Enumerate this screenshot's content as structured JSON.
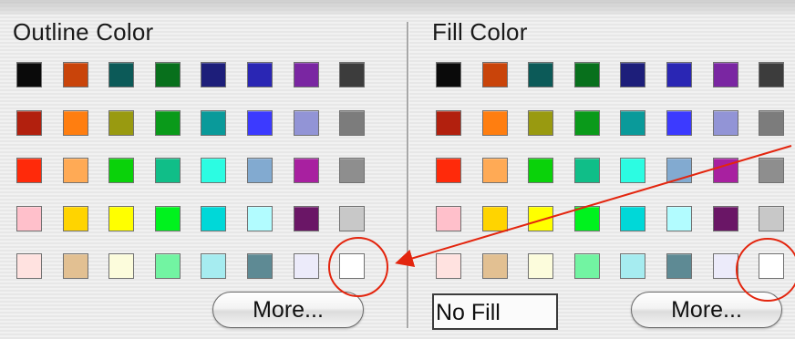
{
  "outline_panel": {
    "title": "Outline Color",
    "more_label": "More..."
  },
  "fill_panel": {
    "title": "Fill Color",
    "no_fill_label": "No Fill",
    "more_label": "More..."
  },
  "palette": [
    [
      "#0a0a0a",
      "#c9440a",
      "#0c5a58",
      "#08701c",
      "#1d1e7a",
      "#2a26b4",
      "#7a26a2",
      "#3c3c3c"
    ],
    [
      "#b2200e",
      "#ff7e10",
      "#999a10",
      "#0a9a1a",
      "#0a9a9a",
      "#3c3aff",
      "#9294d6",
      "#7c7c7c"
    ],
    [
      "#ff2a0a",
      "#ffaa55",
      "#0ad20a",
      "#10be88",
      "#2cfce2",
      "#82aad0",
      "#a820a0",
      "#8e8e8e"
    ],
    [
      "#ffc0cb",
      "#ffd400",
      "#ffff00",
      "#00f21e",
      "#00d8d8",
      "#b2fcff",
      "#6a1666",
      "#c8c8c8"
    ],
    [
      "#ffe2e0",
      "#e2c092",
      "#fcfcdc",
      "#72f4a2",
      "#a6ecf0",
      "#5e8a94",
      "#ecebfa",
      "#ffffff"
    ]
  ],
  "annotation_color": "#e3250e"
}
